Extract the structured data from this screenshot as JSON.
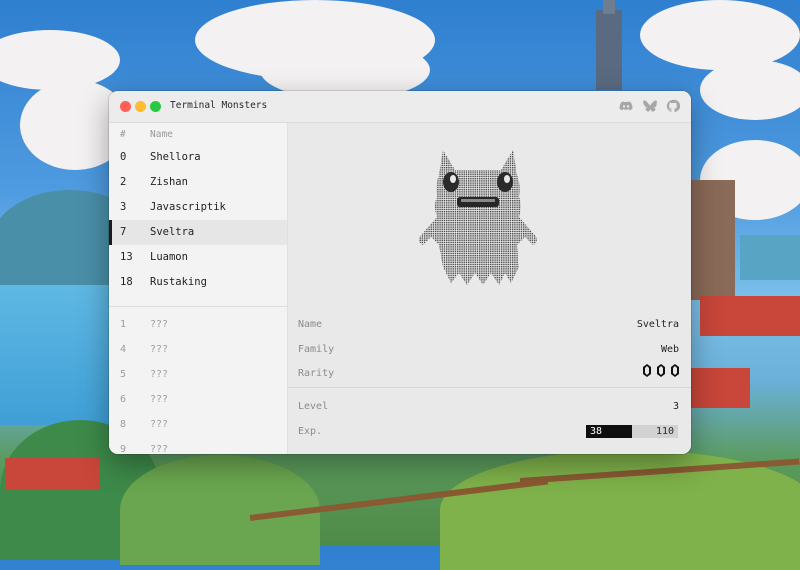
{
  "window": {
    "title": "Terminal Monsters",
    "toolbar_icons": [
      "discord-icon",
      "bluesky-icon",
      "github-icon"
    ]
  },
  "list": {
    "header": {
      "num": "#",
      "name": "Name"
    },
    "caught": [
      {
        "num": "0",
        "name": "Shellora"
      },
      {
        "num": "2",
        "name": "Zishan"
      },
      {
        "num": "3",
        "name": "Javascriptik"
      },
      {
        "num": "7",
        "name": "Sveltra"
      },
      {
        "num": "13",
        "name": "Luamon"
      },
      {
        "num": "18",
        "name": "Rustaking"
      }
    ],
    "selected_index": 3,
    "locked": [
      {
        "num": "1",
        "name": "???"
      },
      {
        "num": "4",
        "name": "???"
      },
      {
        "num": "5",
        "name": "???"
      },
      {
        "num": "6",
        "name": "???"
      },
      {
        "num": "8",
        "name": "???"
      },
      {
        "num": "9",
        "name": "???"
      }
    ]
  },
  "detail": {
    "name_label": "Name",
    "name_value": "Sveltra",
    "family_label": "Family",
    "family_value": "Web",
    "rarity_label": "Rarity",
    "rarity_count": 3,
    "level_label": "Level",
    "level_value": "3",
    "exp_label": "Exp.",
    "exp_current": "38",
    "exp_max": "110",
    "exp_fraction": 0.5
  },
  "colors": {
    "close": "#ff5f57",
    "minimize": "#febc2e",
    "zoom": "#28c840",
    "selection_marker": "#1c1c1c",
    "exp_fill": "#0f0f0f"
  }
}
